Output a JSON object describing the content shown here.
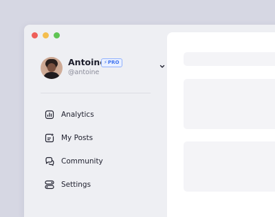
{
  "window": {
    "controls": [
      {
        "name": "close",
        "color": "#ee5f5a"
      },
      {
        "name": "minimize",
        "color": "#f4be4f"
      },
      {
        "name": "maximize",
        "color": "#5fc454"
      }
    ]
  },
  "profile": {
    "name": "Antoine",
    "badge": "PRO",
    "badge_icon": "lightning-icon",
    "handle": "@antoine",
    "dropdown_icon": "chevron-down-icon"
  },
  "nav": {
    "items": [
      {
        "label": "Analytics",
        "icon": "bar-chart-icon"
      },
      {
        "label": "My Posts",
        "icon": "document-icon"
      },
      {
        "label": "Community",
        "icon": "chat-bubbles-icon"
      },
      {
        "label": "Settings",
        "icon": "toggle-icon"
      }
    ]
  },
  "colors": {
    "background": "#d6d7e3",
    "sidebar": "#eeeff3",
    "content": "#ffffff",
    "placeholder": "#f4f4f7",
    "accent": "#3f73f0",
    "text": "#1d1e2c",
    "muted": "#8a8b99"
  }
}
